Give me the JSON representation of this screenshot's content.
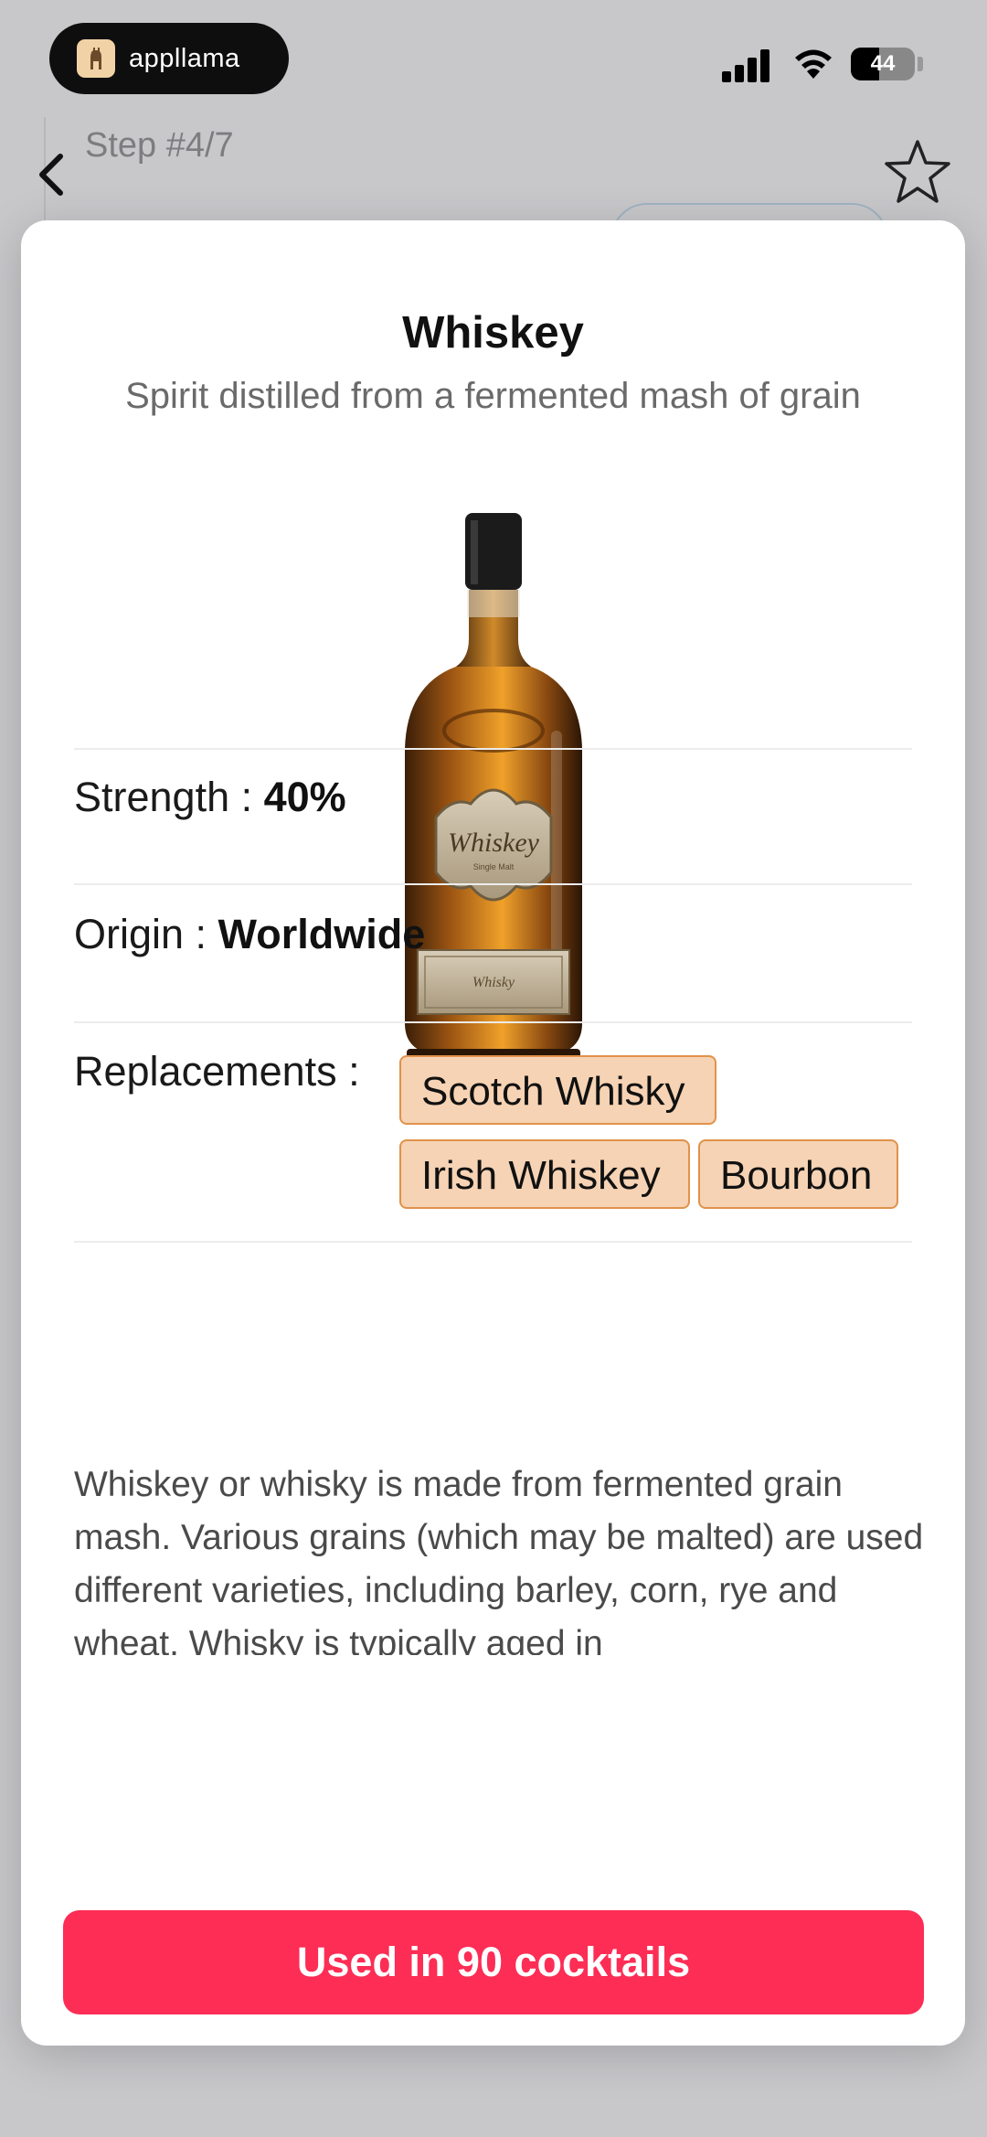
{
  "status_bar": {
    "app_name": "appllama",
    "battery": "44",
    "battery_level": 0.44
  },
  "background": {
    "step_label": "Step #4/7"
  },
  "ingredient": {
    "name": "Whiskey",
    "description": "Spirit distilled from a fermented mash of grain",
    "bottle_label": "Whiskey",
    "bottle_sublabel": "Single Malt",
    "bottle_lower_label": "Whisky",
    "strength_label": "Strength : ",
    "strength_value": "40%",
    "origin_label": "Origin : ",
    "origin_value": "Worldwide",
    "replacements_label": "Replacements :",
    "replacements": [
      "Scotch Whisky",
      "Irish Whiskey",
      "Bourbon"
    ],
    "long_description": "Whiskey or whisky is made from fermented grain mash. Various grains (which may be malted) are used different varieties, including barley, corn, rye and wheat. Whisky is typically aged in"
  },
  "cta": {
    "label": "Used in 90 cocktails"
  },
  "colors": {
    "cta": "#fd2d55",
    "chip_bg": "#f6d3b4",
    "chip_border": "#e0924a"
  }
}
